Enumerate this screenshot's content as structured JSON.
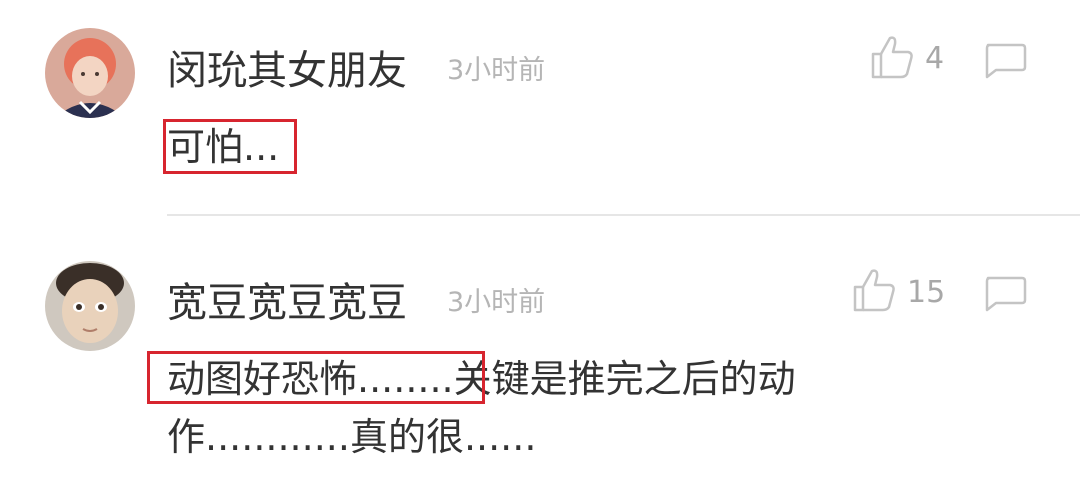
{
  "comments": [
    {
      "username": "闵玧其女朋友",
      "time": "3小时前",
      "likes": "4",
      "text": "可怕..."
    },
    {
      "username": "宽豆宽豆宽豆",
      "time": "3小时前",
      "likes": "15",
      "text_line1": "动图好恐怖........关键是推完之后的动",
      "text_line2": "作............真的很......"
    }
  ],
  "colors": {
    "highlight": "#d7252f",
    "username": "#333333",
    "meta": "#b5b5b5"
  }
}
